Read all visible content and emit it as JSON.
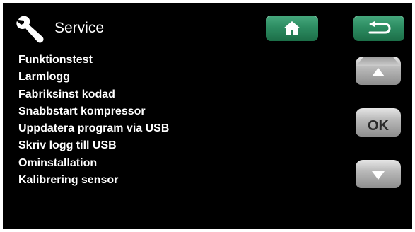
{
  "header": {
    "title": "Service",
    "icon": "wrench-icon",
    "home_icon": "home-icon",
    "back_icon": "back-arrow-icon",
    "accent_color": "#2d8d62"
  },
  "menu": {
    "items": [
      {
        "label": "Funktionstest"
      },
      {
        "label": "Larmlogg"
      },
      {
        "label": "Fabriksinst kodad"
      },
      {
        "label": "Snabbstart kompressor"
      },
      {
        "label": "Uppdatera program via USB"
      },
      {
        "label": "Skriv logg till USB"
      },
      {
        "label": "Ominstallation"
      },
      {
        "label": "Kalibrering sensor"
      }
    ]
  },
  "side_buttons": {
    "up_icon": "arrow-up-icon",
    "ok_label": "OK",
    "down_icon": "arrow-down-icon"
  }
}
